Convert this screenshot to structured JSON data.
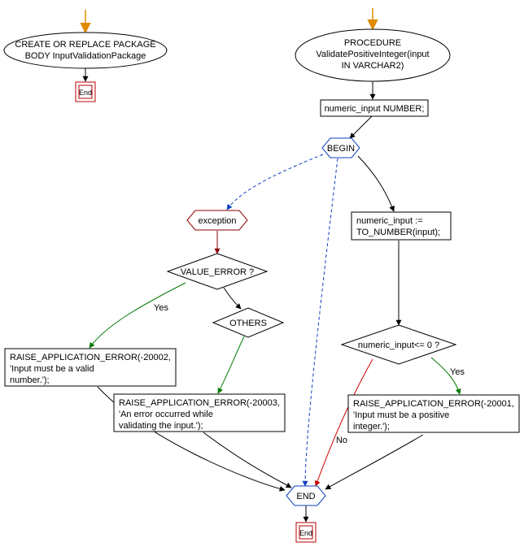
{
  "chart_data": {
    "type": "flowchart",
    "nodes": [
      {
        "id": "n1",
        "shape": "ellipse",
        "label": "CREATE OR REPLACE PACKAGE BODY InputValidationPackage"
      },
      {
        "id": "n1e",
        "shape": "terminator",
        "label": "End"
      },
      {
        "id": "n2",
        "shape": "ellipse",
        "label": "PROCEDURE ValidatePositiveInteger(input IN VARCHAR2)"
      },
      {
        "id": "n3",
        "shape": "process",
        "label": "numeric_input NUMBER;"
      },
      {
        "id": "n4",
        "shape": "hexagon",
        "label": "BEGIN"
      },
      {
        "id": "n5",
        "shape": "hexagon",
        "label": "exception"
      },
      {
        "id": "n6",
        "shape": "decision",
        "label": "VALUE_ERROR ?"
      },
      {
        "id": "n7",
        "shape": "decision",
        "label": "OTHERS"
      },
      {
        "id": "n8",
        "shape": "process",
        "label": "RAISE_APPLICATION_ERROR(-20002, 'Input must be a valid number.');"
      },
      {
        "id": "n9",
        "shape": "process",
        "label": "RAISE_APPLICATION_ERROR(-20003, 'An error occurred while validating the input.');"
      },
      {
        "id": "n10",
        "shape": "process",
        "label": "numeric_input := TO_NUMBER(input);"
      },
      {
        "id": "n11",
        "shape": "decision",
        "label": "numeric_input<= 0 ?"
      },
      {
        "id": "n12",
        "shape": "process",
        "label": "RAISE_APPLICATION_ERROR(-20001, 'Input must be a positive integer.');"
      },
      {
        "id": "n13",
        "shape": "hexagon",
        "label": "END"
      },
      {
        "id": "n13e",
        "shape": "terminator",
        "label": "End"
      }
    ],
    "edges": [
      {
        "from": "entry1",
        "to": "n1",
        "color": "orange"
      },
      {
        "from": "n1",
        "to": "n1e",
        "color": "black"
      },
      {
        "from": "entry2",
        "to": "n2",
        "color": "orange"
      },
      {
        "from": "n2",
        "to": "n3",
        "color": "black"
      },
      {
        "from": "n3",
        "to": "n4",
        "color": "black"
      },
      {
        "from": "n4",
        "to": "n5",
        "color": "blue",
        "style": "dashed"
      },
      {
        "from": "n5",
        "to": "n6",
        "color": "darkred"
      },
      {
        "from": "n6",
        "to": "n8",
        "color": "green",
        "label": "Yes"
      },
      {
        "from": "n6",
        "to": "n7",
        "color": "black"
      },
      {
        "from": "n7",
        "to": "n9",
        "color": "green"
      },
      {
        "from": "n8",
        "to": "n13",
        "color": "black"
      },
      {
        "from": "n9",
        "to": "n13",
        "color": "black"
      },
      {
        "from": "n4",
        "to": "n10",
        "color": "black"
      },
      {
        "from": "n10",
        "to": "n11",
        "color": "black"
      },
      {
        "from": "n11",
        "to": "n12",
        "color": "green",
        "label": "Yes"
      },
      {
        "from": "n11",
        "to": "n13",
        "color": "red",
        "label": "No"
      },
      {
        "from": "n12",
        "to": "n13",
        "color": "black"
      },
      {
        "from": "n4",
        "to": "n13",
        "color": "blue",
        "style": "dashed"
      },
      {
        "from": "n13",
        "to": "n13e",
        "color": "black"
      }
    ]
  },
  "labels": {
    "yes": "Yes",
    "no": "No",
    "end": "End",
    "n1a": "CREATE OR REPLACE PACKAGE",
    "n1b": "BODY InputValidationPackage",
    "n2a": "PROCEDURE",
    "n2b": "ValidatePositiveInteger(input",
    "n2c": "IN VARCHAR2)",
    "n3": "numeric_input NUMBER;",
    "n4": "BEGIN",
    "n5": "exception",
    "n6": "VALUE_ERROR ?",
    "n7": "OTHERS",
    "n8a": "RAISE_APPLICATION_ERROR(-20002,",
    "n8b": "'Input must be a valid",
    "n8c": "number.');",
    "n9a": "RAISE_APPLICATION_ERROR(-20003,",
    "n9b": "'An error occurred while",
    "n9c": "validating the input.');",
    "n10a": "numeric_input :=",
    "n10b": "TO_NUMBER(input);",
    "n11": "numeric_input<= 0 ?",
    "n12a": "RAISE_APPLICATION_ERROR(-20001,",
    "n12b": "'Input must be a positive",
    "n12c": "integer.');",
    "n13": "END"
  }
}
